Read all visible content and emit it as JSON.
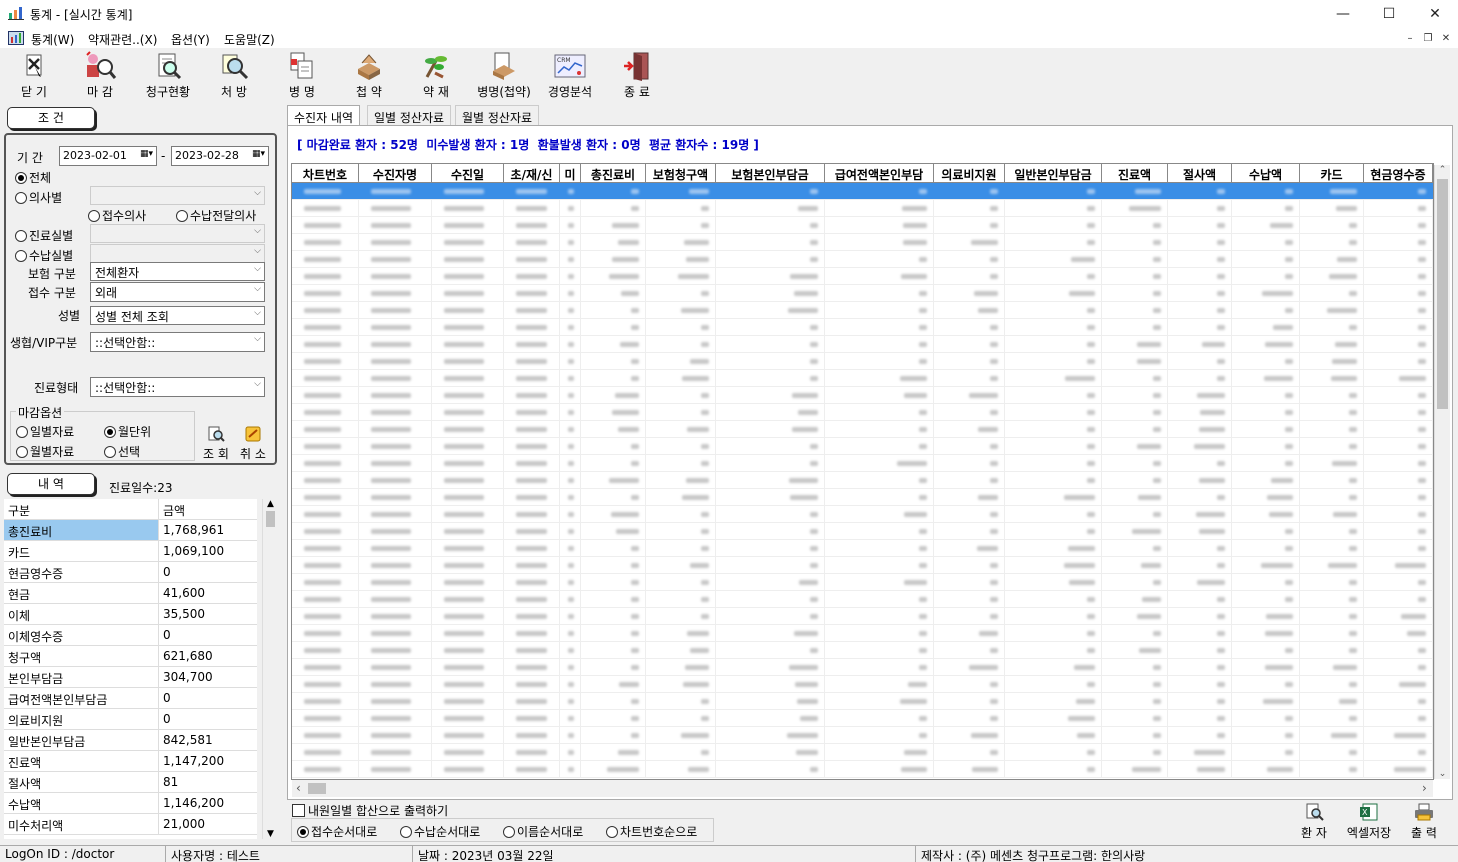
{
  "window": {
    "title": "통계 - [실시간 통계]"
  },
  "menu": [
    "통계(W)",
    "약재관련..(X)",
    "옵션(Y)",
    "도움말(Z)"
  ],
  "toolbar": [
    {
      "label": "닫 기",
      "icon": "close-doc-icon"
    },
    {
      "label": "마 감",
      "icon": "deadline-icon"
    },
    {
      "label": "청구현황",
      "icon": "claim-status-icon"
    },
    {
      "label": "처 방",
      "icon": "prescription-icon"
    },
    {
      "label": "병 명",
      "icon": "disease-name-icon"
    },
    {
      "label": "첩 약",
      "icon": "herbal-packet-icon"
    },
    {
      "label": "약 재",
      "icon": "herb-material-icon"
    },
    {
      "label": "병명(첩약)",
      "icon": "disease-herbal-icon"
    },
    {
      "label": "경영분석",
      "icon": "crm-chart-icon"
    },
    {
      "label": "종 료",
      "icon": "exit-door-icon"
    }
  ],
  "conditions": {
    "header": "조  건",
    "period_label": "기 간",
    "date_from": "2023-02-01",
    "date_sep": "-",
    "date_to": "2023-02-28",
    "opt_all": "전체",
    "opt_doctor": "의사별",
    "opt_recv_doctor": "접수의사",
    "opt_pay_doctor": "수납전달의사",
    "opt_treat_room": "진료실별",
    "opt_pay_room": "수납실별",
    "ins_label": "보험 구분",
    "ins_value": "전체환자",
    "recv_label": "접수 구분",
    "recv_value": "외래",
    "sex_label": "성별",
    "sex_value": "성별 전체 조회",
    "vip_label": "생협/VIP구분",
    "vip_value": "::선택안함::",
    "form_label": "진료형태",
    "form_value": "::선택안함::",
    "close_opt_label": "마감옵션",
    "opt_daily": "일별자료",
    "opt_month_unit": "월단위",
    "opt_monthly": "월별자료",
    "opt_select": "선택",
    "btn_query": "조 회",
    "btn_cancel": "취 소"
  },
  "detail": {
    "header": "내  역",
    "days_label": "진료일수:23",
    "col_category": "구분",
    "col_amount": "금액",
    "rows": [
      {
        "k": "총진료비",
        "v": "1,768,961"
      },
      {
        "k": "카드",
        "v": "1,069,100"
      },
      {
        "k": "현금영수증",
        "v": "0"
      },
      {
        "k": "현금",
        "v": "41,600"
      },
      {
        "k": "이체",
        "v": "35,500"
      },
      {
        "k": "이체영수증",
        "v": "0"
      },
      {
        "k": "청구액",
        "v": "621,680"
      },
      {
        "k": "본인부담금",
        "v": "304,700"
      },
      {
        "k": "급여전액본인부담금",
        "v": "0"
      },
      {
        "k": "의료비지원",
        "v": "0"
      },
      {
        "k": "일반본인부담금",
        "v": "842,581"
      },
      {
        "k": "진료액",
        "v": "1,147,200"
      },
      {
        "k": "절사액",
        "v": "81"
      },
      {
        "k": "수납액",
        "v": "1,146,200"
      },
      {
        "k": "미수처리액",
        "v": "21,000"
      }
    ]
  },
  "tabs": [
    "수진자 내역",
    "일별 정산자료",
    "월별 정산자료"
  ],
  "summary": "[ 마감완료 환자 : 52명  미수발생 환자 : 1명  환불발생 환자 : 0명  평균 환자수 : 19명 ]",
  "grid": {
    "columns": [
      "차트번호",
      "수진자명",
      "수진일",
      "초/재/신",
      "미",
      "총진료비",
      "보험청구액",
      "보험본인부담금",
      "급여전액본인부담",
      "의료비지원",
      "일반본인부담금",
      "진료액",
      "절사액",
      "수납액",
      "카드",
      "현금영수증"
    ]
  },
  "bottom": {
    "merge_print": "내원일별 합산으로 출력하기",
    "sort_recv": "접수순서대로",
    "sort_pay": "수납순서대로",
    "sort_name": "이름순서대로",
    "sort_chart": "차트번호순으로",
    "btn_patient": "환 자",
    "btn_excel": "엑셀저장",
    "btn_print": "출 력"
  },
  "status": {
    "logon": "LogOn ID : /doctor",
    "user": "사용자명 : 테스트",
    "date": "날짜 : 2023년 03월 22일",
    "maker": "제작사 : (주) 메센츠 청구프로그램: 한의사랑"
  },
  "colors": {
    "selection": "#3a8ee6",
    "summary_text": "#0000c8",
    "selected_cell": "#99c9ef"
  }
}
